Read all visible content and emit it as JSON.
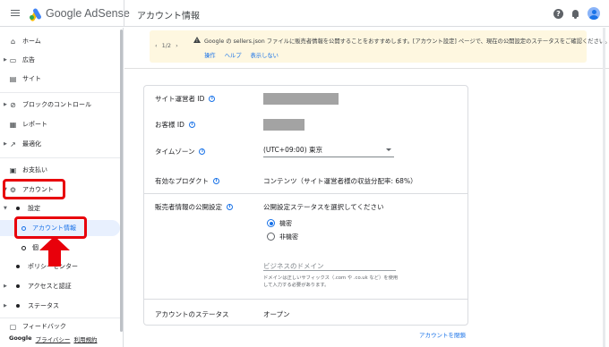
{
  "header": {
    "app_name": "Google AdSense",
    "page_title": "アカウント情報",
    "help_icon": "help-icon",
    "notification_icon": "bell-icon"
  },
  "sidebar": {
    "items": [
      {
        "label": "ホーム",
        "icon": "home-icon"
      },
      {
        "label": "広告",
        "icon": "ads-icon"
      },
      {
        "label": "サイト",
        "icon": "sites-icon"
      },
      {
        "label": "ブロックのコントロール",
        "icon": "block-icon"
      },
      {
        "label": "レポート",
        "icon": "report-icon"
      },
      {
        "label": "最適化",
        "icon": "trend-icon"
      },
      {
        "label": "お支払い",
        "icon": "payment-icon"
      },
      {
        "label": "アカウント",
        "icon": "gear-icon"
      }
    ],
    "sub_items": [
      {
        "label": "設定"
      },
      {
        "label": "アカウント情報"
      },
      {
        "label": "個"
      },
      {
        "label": "ポリシーセンター"
      },
      {
        "label": "アクセスと認証"
      },
      {
        "label": "ステータス"
      }
    ],
    "feedback": "フィードバック",
    "footer": {
      "brand": "Google",
      "privacy": "プライバシー",
      "terms": "利用規約"
    }
  },
  "banner": {
    "pager": "1/2",
    "prev": "‹",
    "next": "›",
    "message": "Google の sellers.json ファイルに販売者情報を公開することをおすすめします。[アカウント設定] ページで、現在の公開設定のステータスをご確認ください。",
    "actions": [
      "操作",
      "ヘルプ",
      "表示しない"
    ]
  },
  "account": {
    "publisher_id_label": "サイト運営者 ID",
    "customer_id_label": "お客様 ID",
    "timezone_label": "タイムゾーン",
    "timezone_value": "(UTC+09:00) 東京",
    "products_label": "有効なプロダクト",
    "products_value": "コンテンツ（サイト運営者様の収益分配率: 68%）",
    "publication_label": "販売者情報の公開設定",
    "publication_title": "公開設定ステータスを選択してください",
    "options": [
      "機密",
      "非機密"
    ],
    "selected_option": "機密",
    "domain_placeholder": "ビジネスのドメイン",
    "domain_help": "ドメインは正しいサフィックス（.com や .co.uk など）を使用して入力する必要があります。",
    "status_label": "アカウントのステータス",
    "status_value": "オープン",
    "close_link": "アカウントを閉鎖"
  },
  "colors": {
    "accent": "#1a73e8",
    "highlight": "#e8000b",
    "banner": "#fef7e0"
  }
}
